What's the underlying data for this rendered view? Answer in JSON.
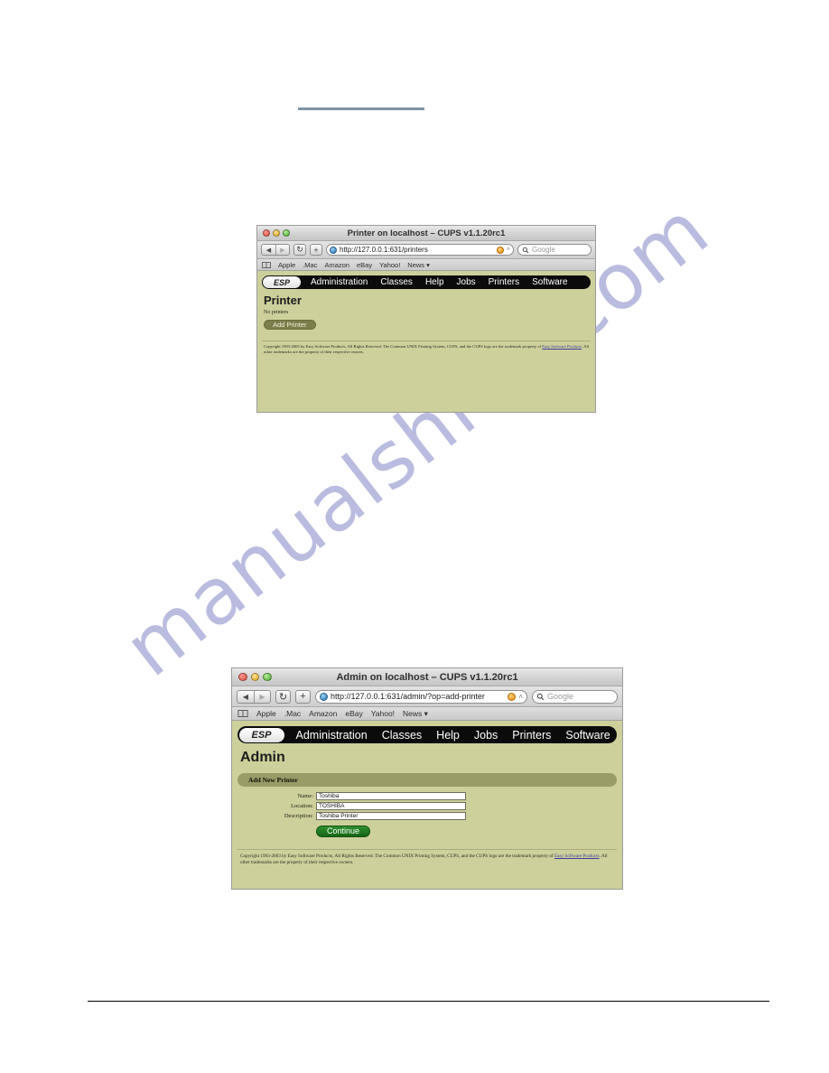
{
  "windows": [
    {
      "id": "printers",
      "title": "Printer on localhost – CUPS v1.1.20rc1",
      "toolbar": {
        "back_icon": "◀",
        "forward_icon": "▶",
        "reload_icon": "↻",
        "add_icon": "+",
        "url": "http://127.0.0.1:631/printers",
        "rss_label": "RSS",
        "separator": "˄",
        "search_placeholder": "Google",
        "search_icon": "search-icon"
      },
      "bookmarks": {
        "book_icon": "book-icon",
        "items": [
          "Apple",
          ".Mac",
          "Amazon",
          "eBay",
          "Yahoo!",
          "News ▾"
        ]
      },
      "cups": {
        "logo": "ESP",
        "nav": [
          "Administration",
          "Classes",
          "Help",
          "Jobs",
          "Printers",
          "Software"
        ],
        "heading": "Printer",
        "body_text": "No printers",
        "button": "Add Printer",
        "footer_pre": "Copyright 1993-2003 by Easy Software Products, All Rights Reserved. The Common UNIX Printing System, CUPS, and the CUPS logo are the trademark property of ",
        "footer_link": "Easy Software Products",
        "footer_post": ". All other trademarks are the property of their respective owners."
      }
    },
    {
      "id": "admin",
      "title": "Admin on localhost – CUPS v1.1.20rc1",
      "toolbar": {
        "back_icon": "◀",
        "forward_icon": "▶",
        "reload_icon": "↻",
        "add_icon": "+",
        "url": "http://127.0.0.1:631/admin/?op=add-printer",
        "rss_label": "RSS",
        "separator": "˄",
        "search_placeholder": "Google",
        "search_icon": "search-icon"
      },
      "bookmarks": {
        "book_icon": "book-icon",
        "items": [
          "Apple",
          ".Mac",
          "Amazon",
          "eBay",
          "Yahoo!",
          "News ▾"
        ]
      },
      "cups": {
        "logo": "ESP",
        "nav": [
          "Administration",
          "Classes",
          "Help",
          "Jobs",
          "Printers",
          "Software"
        ],
        "heading": "Admin",
        "section_title": "Add New Printer",
        "form": [
          {
            "label": "Name:",
            "value": "Toshiba"
          },
          {
            "label": "Location:",
            "value": "TOSHIBA"
          },
          {
            "label": "Description:",
            "value": "Toshiba Printer"
          }
        ],
        "submit": "Continue",
        "footer_pre": "Copyright 1993-2003 by Easy Software Products, All Rights Reserved. The Common UNIX Printing System, CUPS, and the CUPS logo are the trademark property of ",
        "footer_link": "Easy Software Products",
        "footer_post": ". All other trademarks are the property of their respective owners."
      }
    }
  ],
  "watermark": {
    "text": "manualshive.com"
  },
  "colors": {
    "cups_background": "#cdd09b",
    "cups_navbar": "#0b0b0b",
    "cups_pill": "#7e7e4c",
    "cups_section_bar": "#9a9c68",
    "continue_button": "#1d7a1d",
    "top_rule": "#7d93a3",
    "bottom_rule": "#000000",
    "watermark": "#b7b9de"
  }
}
